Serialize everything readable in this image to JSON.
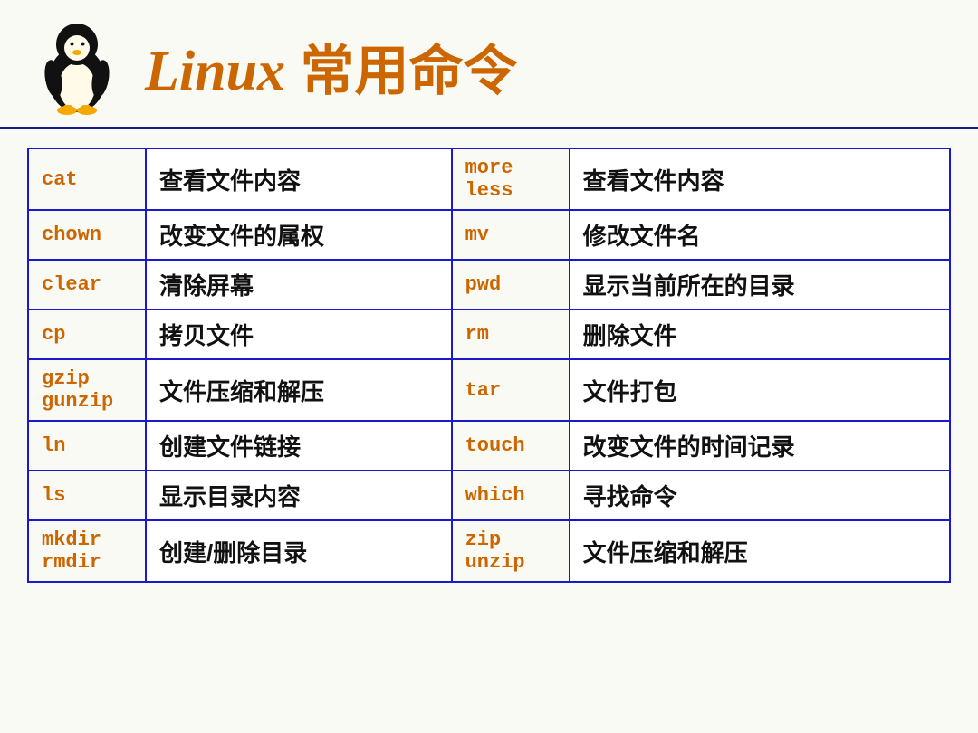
{
  "header": {
    "title_latin": "Linux",
    "title_chinese": "常用命令"
  },
  "table": {
    "rows": [
      {
        "cmd1": "cat",
        "desc1": "查看文件内容",
        "cmd2": "more\nless",
        "desc2": "查看文件内容"
      },
      {
        "cmd1": "chown",
        "desc1": "改变文件的属权",
        "cmd2": "mv",
        "desc2": "修改文件名"
      },
      {
        "cmd1": "clear",
        "desc1": "清除屏幕",
        "cmd2": "pwd",
        "desc2": "显示当前所在的目录"
      },
      {
        "cmd1": "cp",
        "desc1": "拷贝文件",
        "cmd2": "rm",
        "desc2": "删除文件"
      },
      {
        "cmd1": "gzip\ngunzip",
        "desc1": "文件压缩和解压",
        "cmd2": "tar",
        "desc2": "文件打包"
      },
      {
        "cmd1": "ln",
        "desc1": "创建文件链接",
        "cmd2": "touch",
        "desc2": "改变文件的时间记录"
      },
      {
        "cmd1": "ls",
        "desc1": "显示目录内容",
        "cmd2": "which",
        "desc2": "寻找命令"
      },
      {
        "cmd1": "mkdir\nrmdir",
        "desc1": "创建/删除目录",
        "cmd2": "zip\nunzip",
        "desc2": "文件压缩和解压"
      }
    ]
  }
}
